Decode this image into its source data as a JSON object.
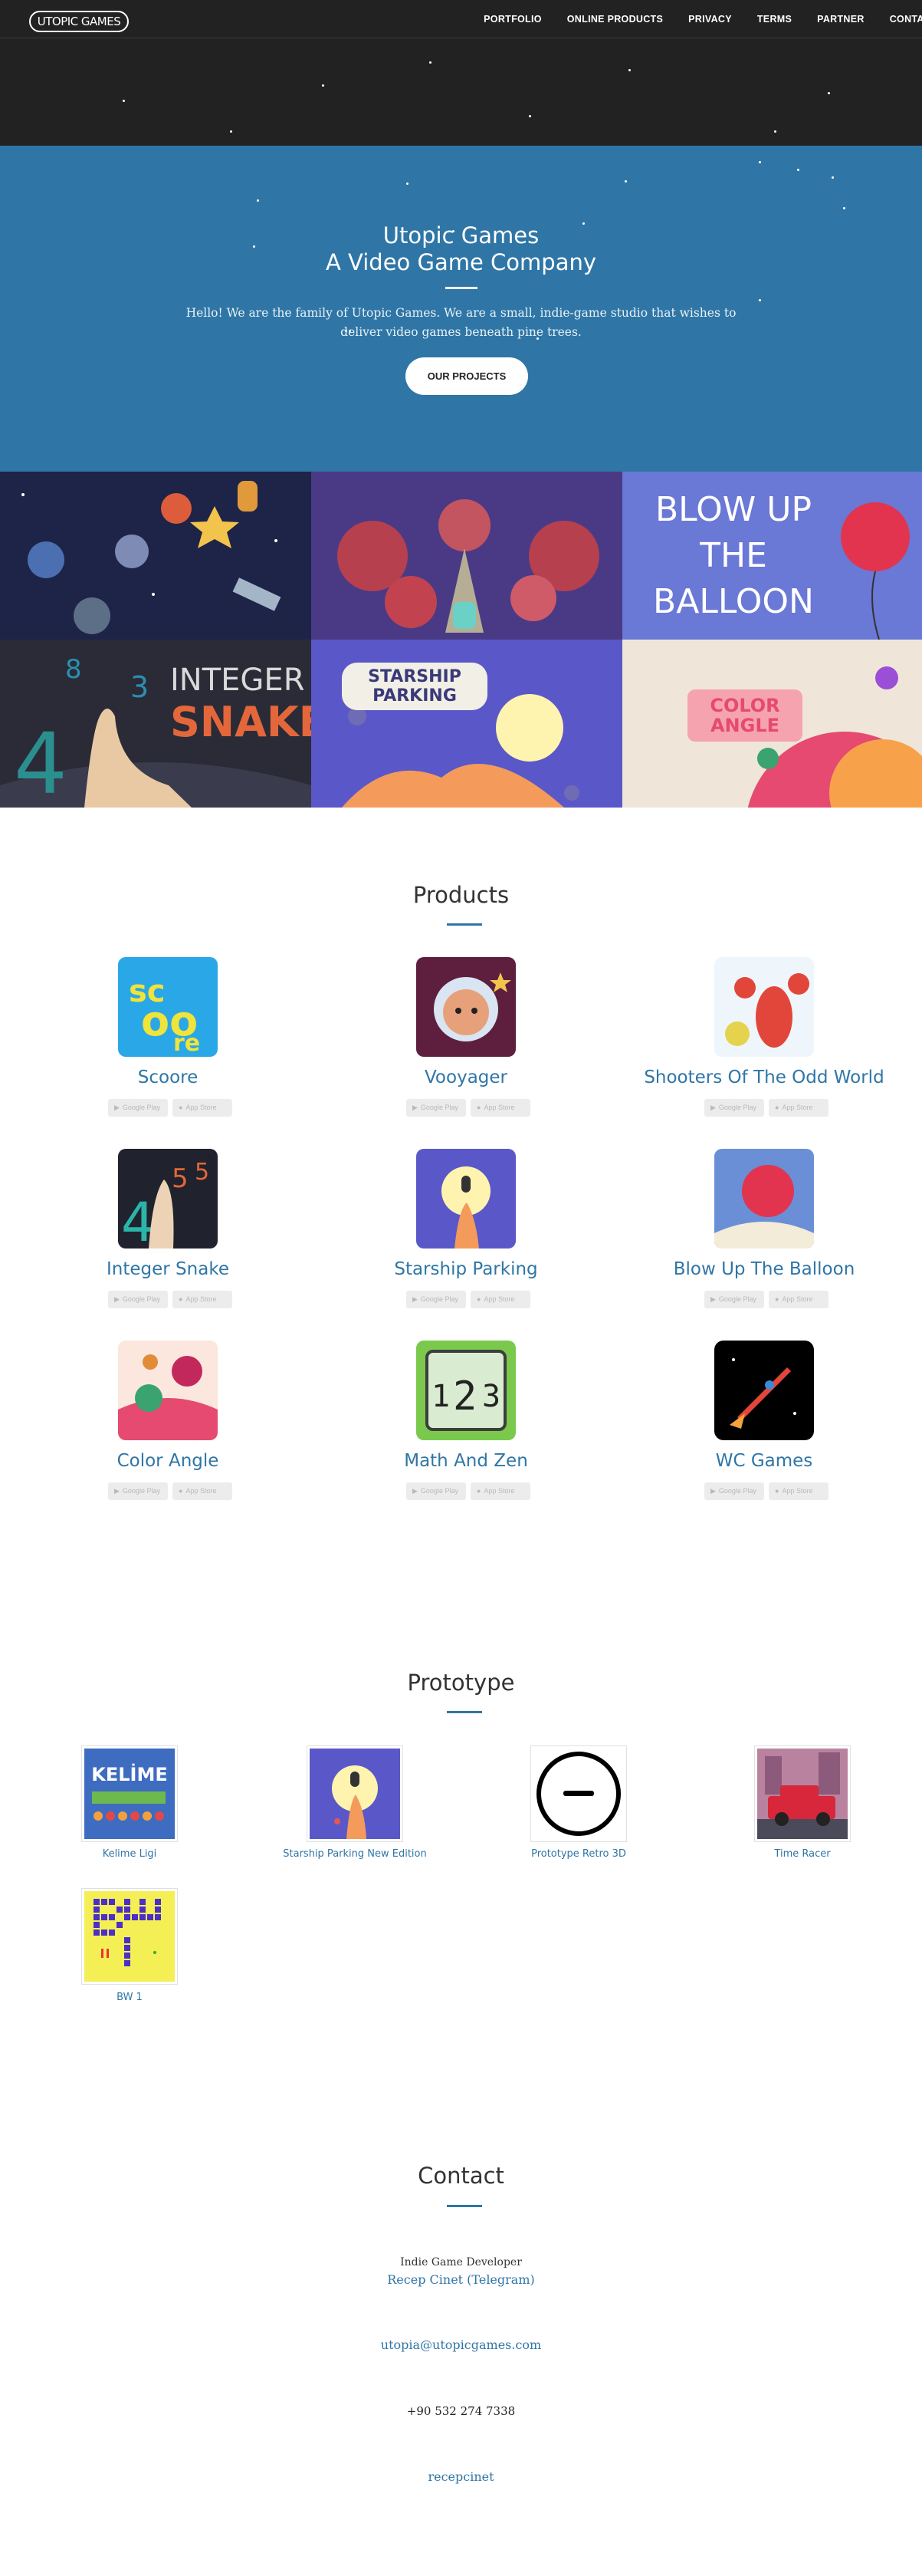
{
  "header": {
    "logo_text": "UTOPIC GAMES",
    "nav": [
      "PORTFOLIO",
      "ONLINE PRODUCTS",
      "PRIVACY",
      "TERMS",
      "PARTNER",
      "CONTACT"
    ]
  },
  "hero": {
    "title_line1": "Utopic Games",
    "title_line2": "A Video Game Company",
    "text": "Hello! We are the family of Utopic Games. We are a small, indie-game studio that wishes to deliver video games beneath pine trees.",
    "button": "OUR PROJECTS"
  },
  "portfolio": {
    "tiles": [
      {
        "label": "",
        "bg": "#1d2448"
      },
      {
        "label": "",
        "bg": "#5a3c8c"
      },
      {
        "label": "BLOW UP THE BALLOON",
        "bg": "#6a78d6"
      },
      {
        "label_a": "INTEGER",
        "label_b": "SNAKE",
        "bg": "#2a2b37"
      },
      {
        "label": "STARSHIP PARKING",
        "bg": "#5a58c8"
      },
      {
        "label": "COLOR ANGLE",
        "bg": "#efe6d9"
      }
    ]
  },
  "products": {
    "title": "Products",
    "store_google": "Google Play",
    "store_apple": "App Store",
    "items": [
      {
        "name": "Scoore",
        "icon": "scoore-icon"
      },
      {
        "name": "Vooyager",
        "icon": "vooyager-icon"
      },
      {
        "name": "Shooters Of The Odd World",
        "icon": "crab-icon"
      },
      {
        "name": "Integer Snake",
        "icon": "integer-snake-icon"
      },
      {
        "name": "Starship Parking",
        "icon": "starship-parking-icon"
      },
      {
        "name": "Blow Up The Balloon",
        "icon": "balloon-icon"
      },
      {
        "name": "Color Angle",
        "icon": "color-angle-icon"
      },
      {
        "name": "Math And Zen",
        "icon": "math-and-zen-icon"
      },
      {
        "name": "WC Games",
        "icon": "rocket-icon"
      }
    ]
  },
  "prototype": {
    "title": "Prototype",
    "items": [
      {
        "name": "Kelime Ligi",
        "icon_text": "KELİME"
      },
      {
        "name": "Starship Parking New Edition"
      },
      {
        "name": "Prototype Retro 3D"
      },
      {
        "name": "Time Racer"
      },
      {
        "name": "BW 1"
      }
    ]
  },
  "contact": {
    "title": "Contact",
    "role": "Indie Game Developer",
    "name_link": "Recep Cinet (Telegram)",
    "email": "utopia@utopicgames.com",
    "phone": "+90 532 274 7338",
    "handle": "recepcinet"
  },
  "colors": {
    "accent": "#2f76a6",
    "dark": "#222222"
  }
}
